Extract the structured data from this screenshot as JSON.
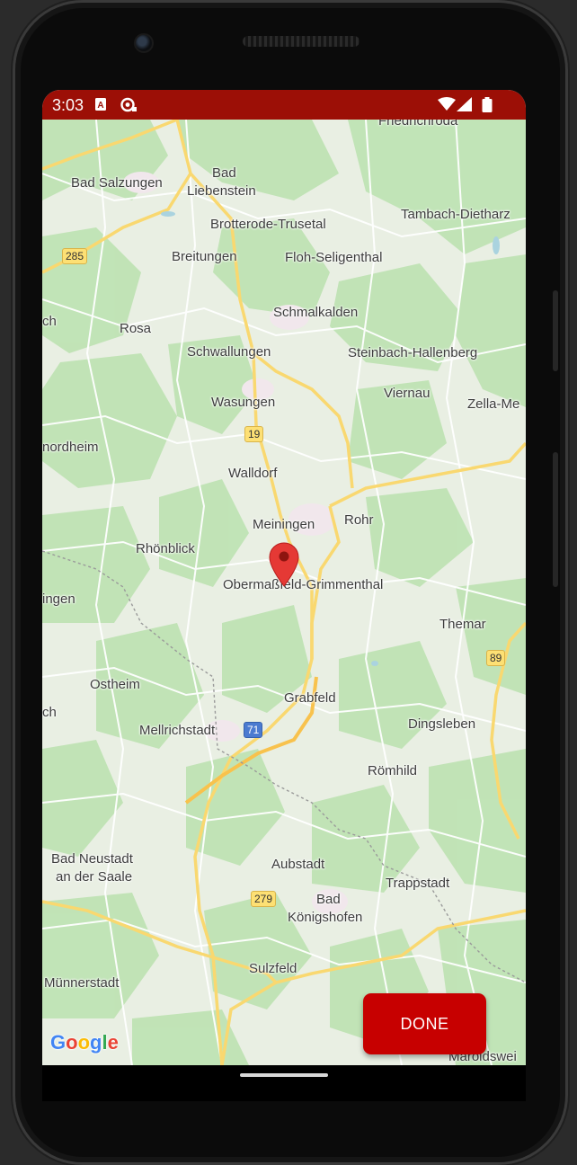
{
  "status_bar": {
    "time": "3:03",
    "background_color": "#9c0f06",
    "icons": [
      "text-a-icon",
      "sync-notification-icon",
      "wifi-icon",
      "cell-signal-icon",
      "battery-icon"
    ]
  },
  "map": {
    "places": {
      "friedrichroda": "Friedrichroda",
      "bad_salzungen": "Bad Salzungen",
      "bad_liebenstein_1": "Bad",
      "bad_liebenstein_2": "Liebenstein",
      "brotterode": "Brotterode-Trusetal",
      "tambach": "Tambach-Dietharz",
      "breitungen": "Breitungen",
      "floh": "Floh-Seligenthal",
      "ch_1": "ch",
      "rosa": "Rosa",
      "schmalkalden": "Schmalkalden",
      "schwallungen": "Schwallungen",
      "steinbach": "Steinbach-Hallenberg",
      "wasungen": "Wasungen",
      "viernau": "Viernau",
      "zella": "Zella-Me",
      "nordheim": "nordheim",
      "walldorf": "Walldorf",
      "meiningen": "Meiningen",
      "rohr": "Rohr",
      "rhoenblick": "Rhönblick",
      "obermassfeld": "Obermaßfeld-Grimmenthal",
      "ingen": "ingen",
      "themar": "Themar",
      "ostheim": "Ostheim",
      "grabfeld": "Grabfeld",
      "ch_2": "ch",
      "mellrichstadt": "Mellrichstadt",
      "dingsleben": "Dingsleben",
      "roemhild": "Römhild",
      "bad_neustadt_1": "Bad Neustadt",
      "bad_neustadt_2": "an der Saale",
      "aubstadt": "Aubstadt",
      "trappstadt": "Trappstadt",
      "bad_koenigshofen_1": "Bad",
      "bad_koenigshofen_2": "Königshofen",
      "sulzfeld": "Sulzfeld",
      "muennerstadt": "Münnerstadt",
      "maroldsweis": "Maroldswei"
    },
    "road_shields": {
      "r285": "285",
      "r19": "19",
      "r89": "89",
      "a71": "71",
      "r279": "279"
    },
    "marker": "location-pin-icon",
    "attribution": {
      "letters": [
        "G",
        "o",
        "o",
        "g",
        "l",
        "e"
      ],
      "colors": [
        "#4285F4",
        "#EA4335",
        "#FBBC05",
        "#4285F4",
        "#34A853",
        "#EA4335"
      ]
    }
  },
  "done_button": {
    "label": "DONE",
    "color": "#c70000"
  }
}
